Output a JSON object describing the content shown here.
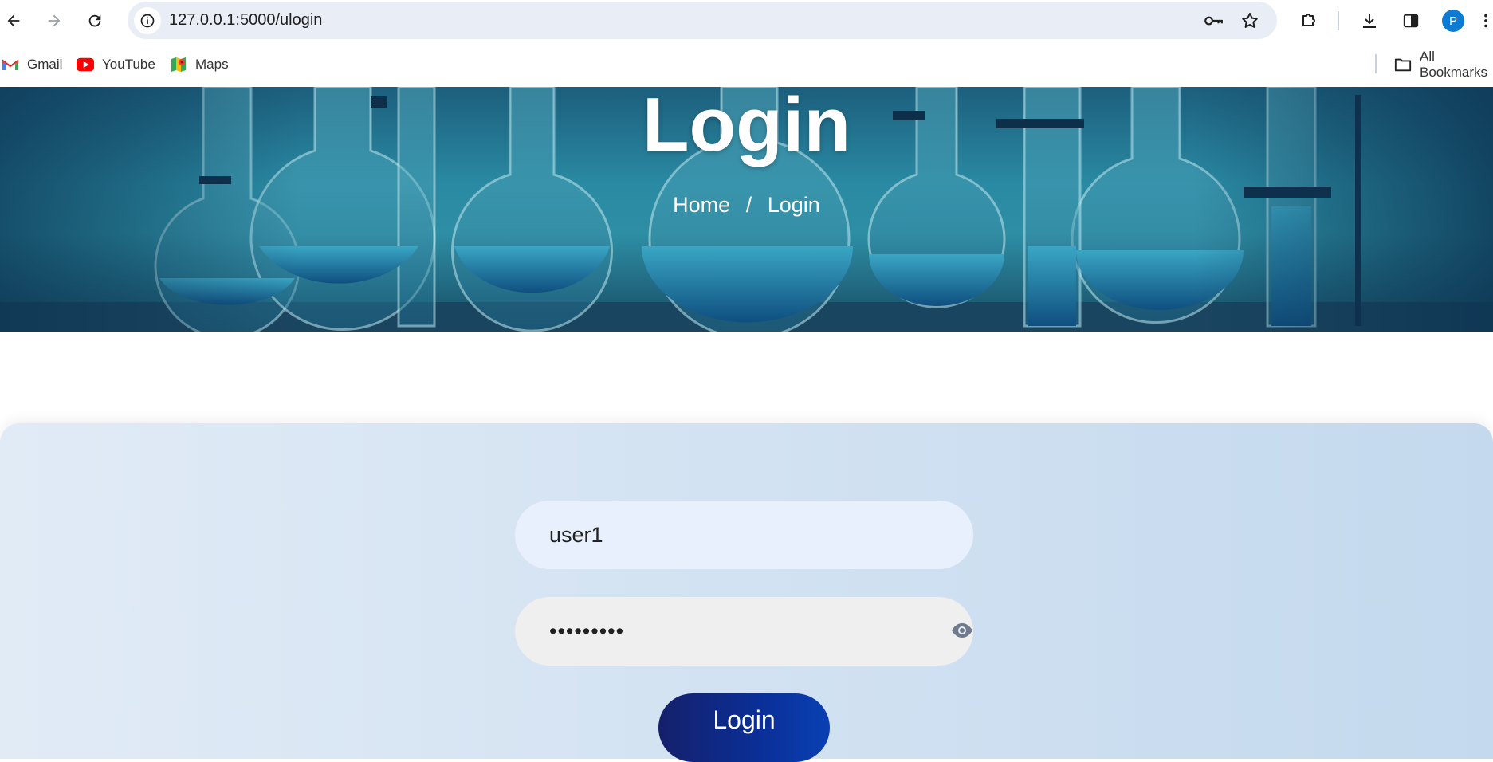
{
  "browser": {
    "url": "127.0.0.1:5000/ulogin",
    "profile_initial": "P",
    "bookmarks": [
      {
        "label": "Gmail",
        "icon": "gmail-icon"
      },
      {
        "label": "YouTube",
        "icon": "youtube-icon"
      },
      {
        "label": "Maps",
        "icon": "maps-icon"
      }
    ],
    "all_bookmarks_label": "All Bookmarks"
  },
  "hero": {
    "title": "Login",
    "breadcrumb": {
      "home": "Home",
      "separator": "/",
      "current": "Login"
    }
  },
  "form": {
    "username_value": "user1",
    "password_value": "•••••••••",
    "submit_label": "Login"
  },
  "colors": {
    "button_gradient_start": "#15206b",
    "button_gradient_end": "#0940b3",
    "form_background": "#d6e5f3",
    "avatar": "#0b7bd4"
  }
}
